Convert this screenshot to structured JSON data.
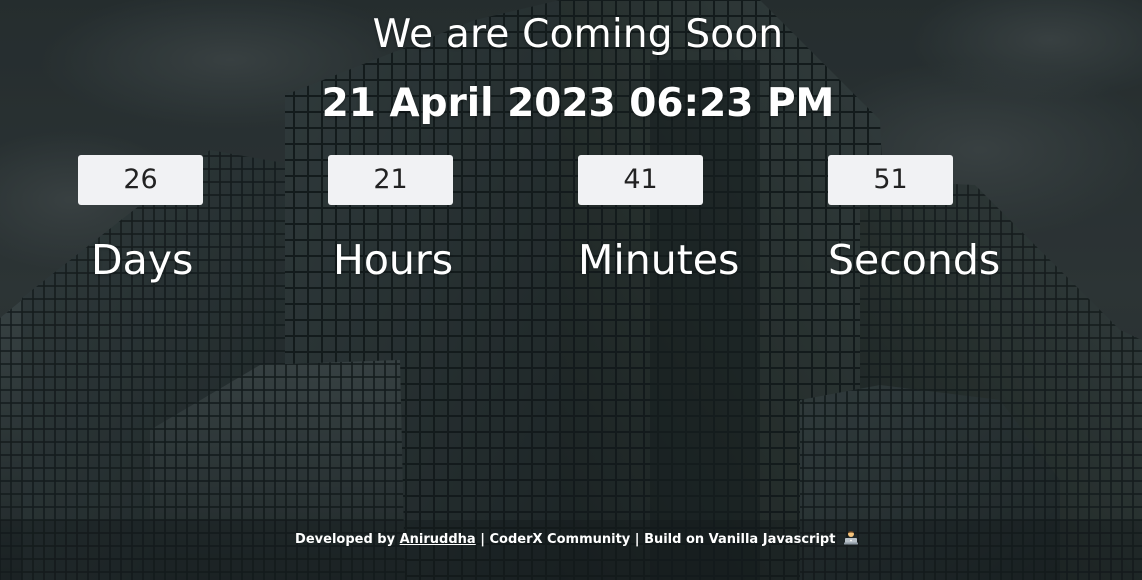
{
  "page": {
    "heading": "We are Coming Soon",
    "launch_datetime": "21 April 2023 06:23 PM"
  },
  "countdown": {
    "days": {
      "value": "26",
      "label": "Days"
    },
    "hours": {
      "value": "21",
      "label": "Hours"
    },
    "minutes": {
      "value": "41",
      "label": "Minutes"
    },
    "seconds": {
      "value": "51",
      "label": "Seconds"
    }
  },
  "footer": {
    "developed_by": "Developed by",
    "author_link": "Aniruddha",
    "rest": "| CoderX Community | Build on Vanilla Javascript",
    "icon": "technologist-emoji-icon"
  },
  "colors": {
    "overlay": "#1c2426",
    "box_background": "#f1f2f4",
    "text": "#ffffff"
  }
}
